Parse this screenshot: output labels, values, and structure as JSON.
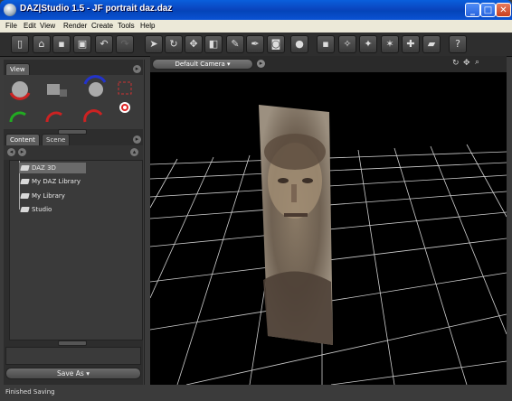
{
  "window": {
    "title": "DAZ|Studio 1.5 - JF portrait daz.daz"
  },
  "menu": [
    "File",
    "Edit",
    "View",
    "Render",
    "Create",
    "Tools",
    "Help"
  ],
  "toolbar": {
    "icons": [
      "new-icon",
      "open-icon",
      "save-icon",
      "save-as-icon",
      "undo-icon",
      "redo-icon",
      "select-icon",
      "rotate-icon",
      "translate-icon",
      "scale-icon",
      "node-select-icon",
      "bones-icon",
      "render-icon",
      "sphere-icon",
      "add-primitive-icon",
      "spotlight-icon",
      "point-light-icon",
      "distant-light-icon",
      "ambient-light-icon",
      "camera-icon",
      "help-icon"
    ]
  },
  "left_panel": {
    "view_tab": "View",
    "content_tab": "Content",
    "scene_tab": "Scene",
    "tree": [
      "DAZ 3D",
      "My DAZ Library",
      "My Library",
      "Studio"
    ],
    "selected": "DAZ 3D",
    "save_button": "Save As"
  },
  "viewport": {
    "camera": "Default Camera"
  },
  "status": "Finished Saving"
}
